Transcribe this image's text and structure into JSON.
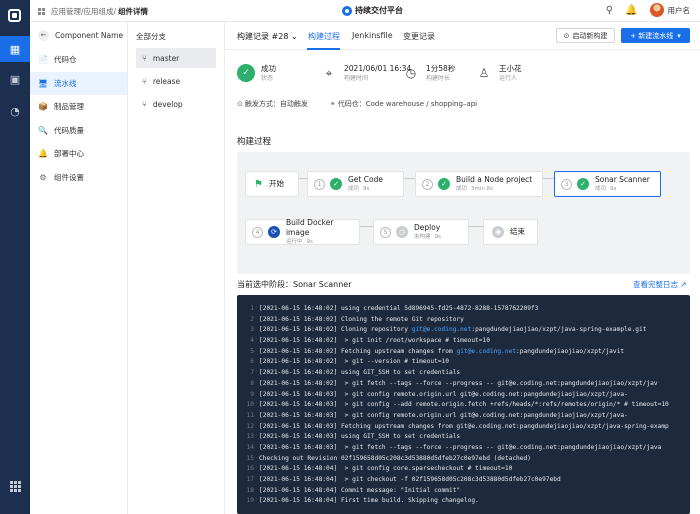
{
  "breadcrumb": {
    "path": "应用管理/应用组成/",
    "current": "组件详情"
  },
  "brand": {
    "name": "持续交付平台"
  },
  "user": {
    "name": "用户名"
  },
  "nav": {
    "project": "Component Name",
    "items": [
      {
        "icon": "📄",
        "label": "代码仓"
      },
      {
        "icon": "🖥",
        "label": "流水线"
      },
      {
        "icon": "📦",
        "label": "制品管理"
      },
      {
        "icon": "🔍",
        "label": "代码质量"
      },
      {
        "icon": "🔔",
        "label": "部署中心"
      },
      {
        "icon": "⚙",
        "label": "组件设置"
      }
    ]
  },
  "branches": {
    "header": "全部分支",
    "items": [
      "master",
      "release",
      "develop"
    ]
  },
  "tabs": {
    "record": "构建记录 #28",
    "items": [
      "构建过程",
      "Jenkinsfile",
      "变更记录"
    ]
  },
  "actions": {
    "start": "启动新构建",
    "new": "+ 新建流水线"
  },
  "summary": [
    {
      "value": "成功",
      "label": "状态"
    },
    {
      "value": "2021/06/01 16:34",
      "label": "构建时间"
    },
    {
      "value": "1分58秒",
      "label": "构建时长"
    },
    {
      "value": "王小花",
      "label": "运行人"
    }
  ],
  "meta": {
    "trigger": "触发方式：自动触发",
    "repo": "代码仓：Code warehouse / shopping–api"
  },
  "process": {
    "title": "构建过程",
    "nodes": [
      {
        "num": "",
        "title": "开始",
        "status": "",
        "time": ""
      },
      {
        "num": "1",
        "title": "Get Code",
        "status": "成功",
        "time": "9s"
      },
      {
        "num": "2",
        "title": "Build a Node project",
        "status": "成功",
        "time": "3min 8s"
      },
      {
        "num": "3",
        "title": "Sonar Scanner",
        "status": "成功",
        "time": "9s"
      },
      {
        "num": "4",
        "title": "Build Docker image",
        "status": "运行中",
        "time": "9s"
      },
      {
        "num": "5",
        "title": "Deploy",
        "status": "未构建",
        "time": "9s"
      },
      {
        "num": "",
        "title": "结束",
        "status": "",
        "time": ""
      }
    ]
  },
  "stage": {
    "title": "当前选中阶段：Sonar Scanner",
    "full_log": "查看完整日志"
  },
  "log": [
    {
      "n": "1",
      "pre": "[2021-06-15 16:48:02] using credential 5d896945-fd25-4872-8288-1578762209f3",
      "hl": "",
      "post": ""
    },
    {
      "n": "2",
      "pre": "[2021-06-15 16:48:02] Cloning the remote Git repository",
      "hl": "",
      "post": ""
    },
    {
      "n": "3",
      "pre": "[2021-06-15 16:48:02] Cloning repository ",
      "hl": "git@e.coding.net",
      "post": ":pangdundejiaojiao/xzpt/java-spring-example.git"
    },
    {
      "n": "4",
      "pre": "[2021-06-15 16:48:02]  > git init /root/workspace # timeout=10",
      "hl": "",
      "post": ""
    },
    {
      "n": "5",
      "pre": "[2021-06-15 16:48:02] Fetching upstream changes from ",
      "hl": "git@e.coding.net",
      "post": ":pangdundejiaojiao/xzpt/javit"
    },
    {
      "n": "6",
      "pre": "[2021-06-15 16:48:02]  > git --version # timeout=10",
      "hl": "",
      "post": ""
    },
    {
      "n": "7",
      "pre": "[2021-06-15 16:48:02] using GIT_SSH to set credentials",
      "hl": "",
      "post": ""
    },
    {
      "n": "8",
      "pre": "[2021-06-15 16:48:02]  > git fetch --tags --force --progress -- git@e.coding.net:pangdundejiaojiao/xzpt/jav",
      "hl": "",
      "post": ""
    },
    {
      "n": "9",
      "pre": "[2021-06-15 16:48:03]  > git config remote.origin.url git@e.coding.net:pangdundejiaojiao/xzpt/java-",
      "hl": "",
      "post": ""
    },
    {
      "n": "10",
      "pre": "[2021-06-15 16:48:03]  > git config --add remote.origin.fetch +refs/heads/*:refs/remotes/origin/* # timeout=10",
      "hl": "",
      "post": ""
    },
    {
      "n": "11",
      "pre": "[2021-06-15 16:48:03]  > git config remote.origin.url git@e.coding.net:pangdundejiaojiao/xzpt/java-",
      "hl": "",
      "post": ""
    },
    {
      "n": "12",
      "pre": "[2021-06-15 16:48:03] Fetching upstream changes from git@e.coding.net:pangdundejiaojiao/xzpt/java-spring-examp",
      "hl": "",
      "post": ""
    },
    {
      "n": "13",
      "pre": "[2021-06-15 16:48:03] using GIT_SSH to set credentials",
      "hl": "",
      "post": ""
    },
    {
      "n": "14",
      "pre": "[2021-06-15 16:48:03]  > git fetch --tags --force --progress -- git@e.coding.net:pangdundejiaojiao/xzpt/java",
      "hl": "",
      "post": ""
    },
    {
      "n": "15",
      "pre": "Checking out Revision 02f159658d05c208c3d53880d5dfeb27c0e97ebd (detached)",
      "hl": "",
      "post": ""
    },
    {
      "n": "16",
      "pre": "[2021-06-15 16:48:04]  > git config core.sparsecheckout # timeout=10",
      "hl": "",
      "post": ""
    },
    {
      "n": "17",
      "pre": "[2021-06-15 16:48:04]  > git checkout -f 02f159658d05c208c3d53880d5dfeb27c0e97ebd",
      "hl": "",
      "post": ""
    },
    {
      "n": "18",
      "pre": "[2021-06-15 16:48:04] Commit message: \"Initial commit\"",
      "hl": "",
      "post": ""
    },
    {
      "n": "19",
      "pre": "[2021-06-15 16:48:04] First time build. Skipping changelog.",
      "hl": "",
      "post": ""
    }
  ],
  "colors": {
    "primary": "#1a6fe8",
    "success": "#2db06b",
    "rail": "#1c2f4e",
    "log_bg": "#1d2a3d"
  }
}
